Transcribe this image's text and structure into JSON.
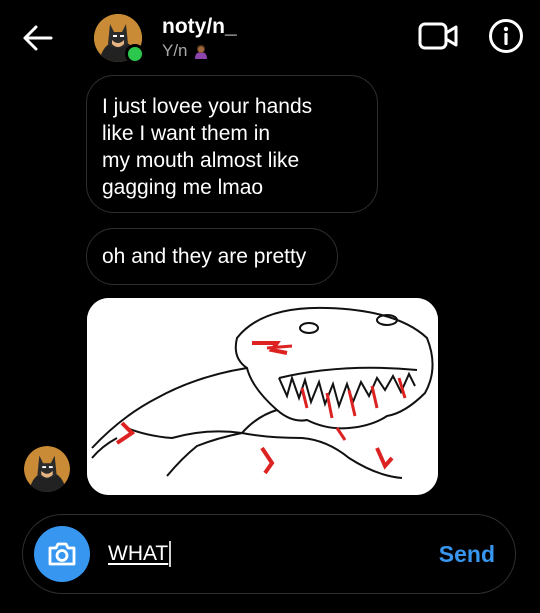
{
  "header": {
    "contact_name": "noty/n_",
    "contact_subtitle": "Y/n",
    "subtitle_emoji_icon": "person-emoji-icon",
    "back_icon": "arrow-left-icon",
    "video_icon": "video-camera-icon",
    "info_icon": "info-icon",
    "online_status_color": "#2cc84d"
  },
  "messages": [
    {
      "type": "text",
      "sender": "contact",
      "lines": [
        "I just lovee your hands",
        "like I want them in",
        "my mouth almost like",
        "gagging me lmao"
      ]
    },
    {
      "type": "text",
      "sender": "contact",
      "lines": [
        "oh and they are pretty"
      ]
    },
    {
      "type": "image",
      "sender": "contact",
      "description_icon": "drawing-image"
    }
  ],
  "composer": {
    "camera_icon": "camera-icon",
    "input_value": "WHAT",
    "send_label": "Send",
    "accent_color": "#3797f0"
  }
}
